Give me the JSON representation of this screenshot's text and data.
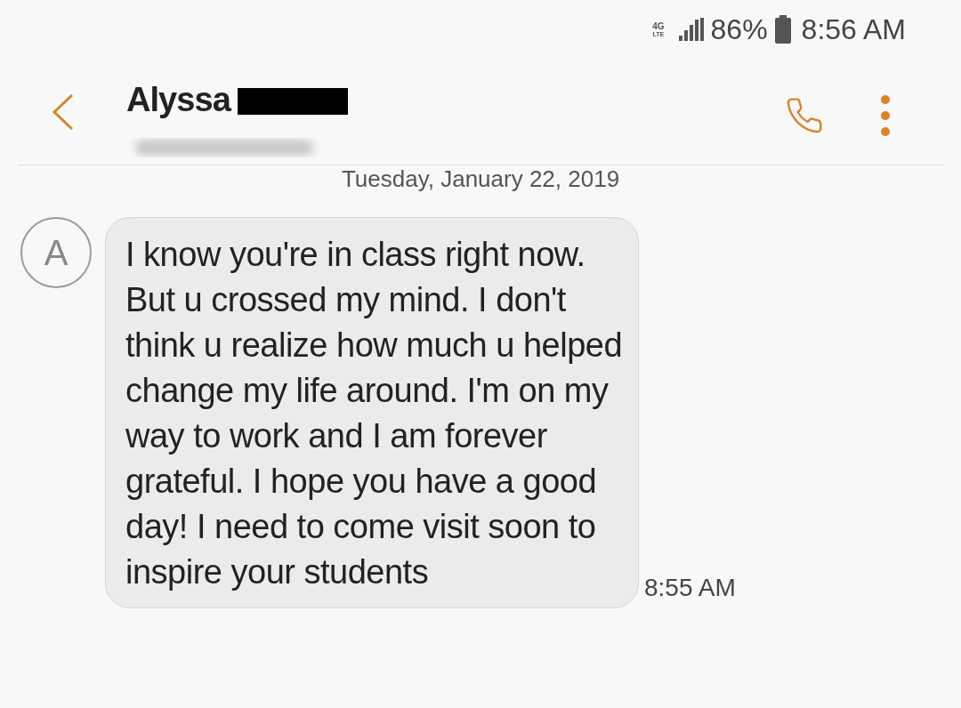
{
  "status_bar": {
    "network": "4G",
    "network_sub": "LTE",
    "battery": "86%",
    "time": "8:56 AM"
  },
  "header": {
    "name": "Alyssa"
  },
  "date": "Tuesday, January 22, 2019",
  "messages": [
    {
      "avatar": "A",
      "text": "I know you're in class right now. But u crossed my mind. I don't think u realize how much u helped change my life around. I'm on my way to work and I am forever grateful. I hope you have a good day! I need to come visit soon to inspire your students",
      "time": "8:55 AM"
    }
  ]
}
